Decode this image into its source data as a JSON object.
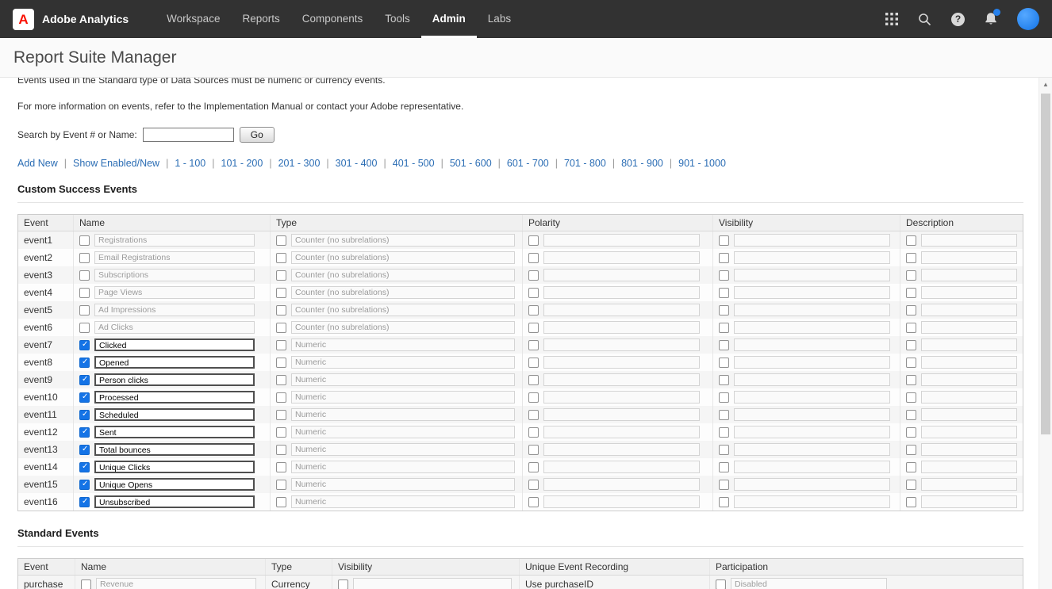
{
  "colors": {
    "accent_blue": "#1473e6",
    "adobe_red": "#fa0f00",
    "topbar_bg": "#323232",
    "link_blue": "#2b6db4",
    "notification_dot": "#2680eb"
  },
  "topbar": {
    "brand": "Adobe Analytics",
    "nav": [
      {
        "label": "Workspace",
        "active": false
      },
      {
        "label": "Reports",
        "active": false
      },
      {
        "label": "Components",
        "active": false
      },
      {
        "label": "Tools",
        "active": false
      },
      {
        "label": "Admin",
        "active": true
      },
      {
        "label": "Labs",
        "active": false
      }
    ],
    "icons": [
      "apps-grid",
      "search",
      "help",
      "notifications",
      "avatar"
    ],
    "help_glyph": "?"
  },
  "page": {
    "title": "Report Suite Manager"
  },
  "intro": {
    "line1": "Events used in the Standard type of Data Sources must be numeric or currency events.",
    "line2": "For more information on events, refer to the Implementation Manual or contact your Adobe representative."
  },
  "search": {
    "label": "Search by Event # or Name:",
    "value": "",
    "go": "Go"
  },
  "pagination": [
    "Add New",
    "Show Enabled/New",
    "1 - 100",
    "101 - 200",
    "201 - 300",
    "301 - 400",
    "401 - 500",
    "501 - 600",
    "601 - 700",
    "701 - 800",
    "801 - 900",
    "901 - 1000"
  ],
  "custom_events": {
    "title": "Custom Success Events",
    "headers": [
      "Event",
      "Name",
      "Type",
      "Polarity",
      "Visibility",
      "Description"
    ],
    "rows": [
      {
        "event": "event1",
        "enabled": false,
        "name": "Registrations",
        "type": "Counter (no subrelations)"
      },
      {
        "event": "event2",
        "enabled": false,
        "name": "Email Registrations",
        "type": "Counter (no subrelations)"
      },
      {
        "event": "event3",
        "enabled": false,
        "name": "Subscriptions",
        "type": "Counter (no subrelations)"
      },
      {
        "event": "event4",
        "enabled": false,
        "name": "Page Views",
        "type": "Counter (no subrelations)"
      },
      {
        "event": "event5",
        "enabled": false,
        "name": "Ad Impressions",
        "type": "Counter (no subrelations)"
      },
      {
        "event": "event6",
        "enabled": false,
        "name": "Ad Clicks",
        "type": "Counter (no subrelations)"
      },
      {
        "event": "event7",
        "enabled": true,
        "name": "Clicked",
        "type": "Numeric"
      },
      {
        "event": "event8",
        "enabled": true,
        "name": "Opened",
        "type": "Numeric"
      },
      {
        "event": "event9",
        "enabled": true,
        "name": "Person clicks",
        "type": "Numeric"
      },
      {
        "event": "event10",
        "enabled": true,
        "name": "Processed",
        "type": "Numeric"
      },
      {
        "event": "event11",
        "enabled": true,
        "name": "Scheduled",
        "type": "Numeric"
      },
      {
        "event": "event12",
        "enabled": true,
        "name": "Sent",
        "type": "Numeric"
      },
      {
        "event": "event13",
        "enabled": true,
        "name": "Total bounces",
        "type": "Numeric"
      },
      {
        "event": "event14",
        "enabled": true,
        "name": "Unique Clicks",
        "type": "Numeric"
      },
      {
        "event": "event15",
        "enabled": true,
        "name": "Unique Opens",
        "type": "Numeric"
      },
      {
        "event": "event16",
        "enabled": true,
        "name": "Unsubscribed",
        "type": "Numeric"
      }
    ]
  },
  "standard_events": {
    "title": "Standard Events",
    "headers": [
      "Event",
      "Name",
      "Type",
      "Visibility",
      "Unique Event Recording",
      "Participation"
    ],
    "rows": [
      {
        "event": "purchase",
        "enabled": false,
        "name": "Revenue",
        "type": "Currency",
        "unique_event_recording": "Use purchaseID",
        "participation": "Disabled"
      }
    ]
  },
  "scrollbar": {
    "up_arrow": "▲"
  }
}
